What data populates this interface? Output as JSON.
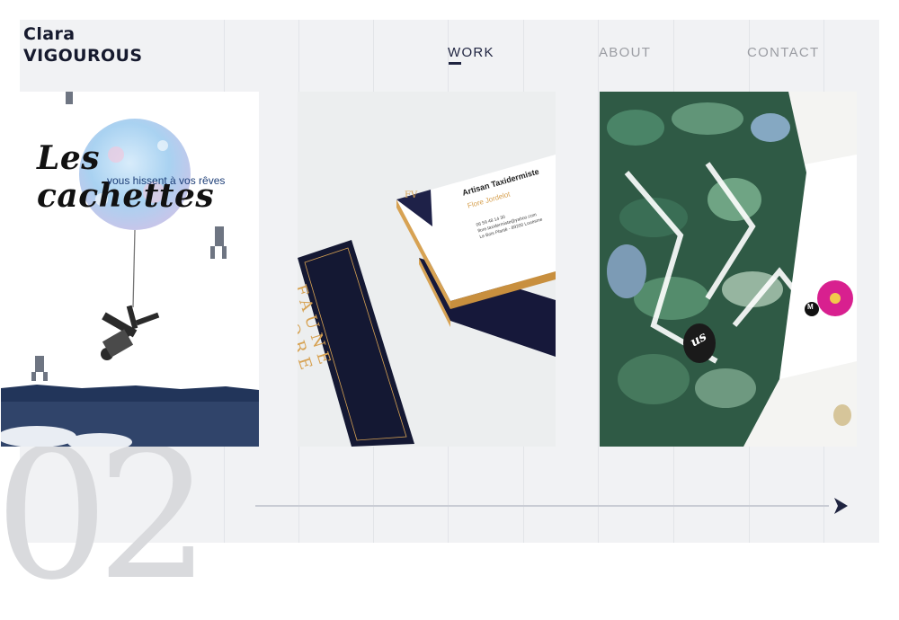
{
  "brand": {
    "first_name": "Clara",
    "last_name": "VIGOUROUS"
  },
  "nav": {
    "items": [
      {
        "label": "WORK",
        "active": true
      },
      {
        "label": "ABOUT",
        "active": false
      },
      {
        "label": "CONTACT",
        "active": false
      }
    ]
  },
  "slide_number": "02",
  "projects": [
    {
      "logo_text": "Les cachettes",
      "tagline": "vous hissent à vos rêves"
    },
    {
      "card_front_lines": [
        "FAUNE",
        "FLORE"
      ],
      "card_monogram": "FV",
      "card_title": "Artisan Taxidermiste",
      "card_name": "Flore Jordelot",
      "card_contact": [
        "06 59 48 14 30",
        "flore.taxidermiste@yahoo.com",
        "Le Bois Planté - 89200 Louesme"
      ]
    },
    {
      "badge": "M",
      "cutout_text": "us"
    }
  ],
  "colors": {
    "navy": "#1f2440",
    "gold": "#d7a253",
    "grey_text": "#9b9da3",
    "background": "#f1f2f4",
    "pink": "#d8208f"
  },
  "icons": {
    "next": "arrow-right-icon"
  }
}
